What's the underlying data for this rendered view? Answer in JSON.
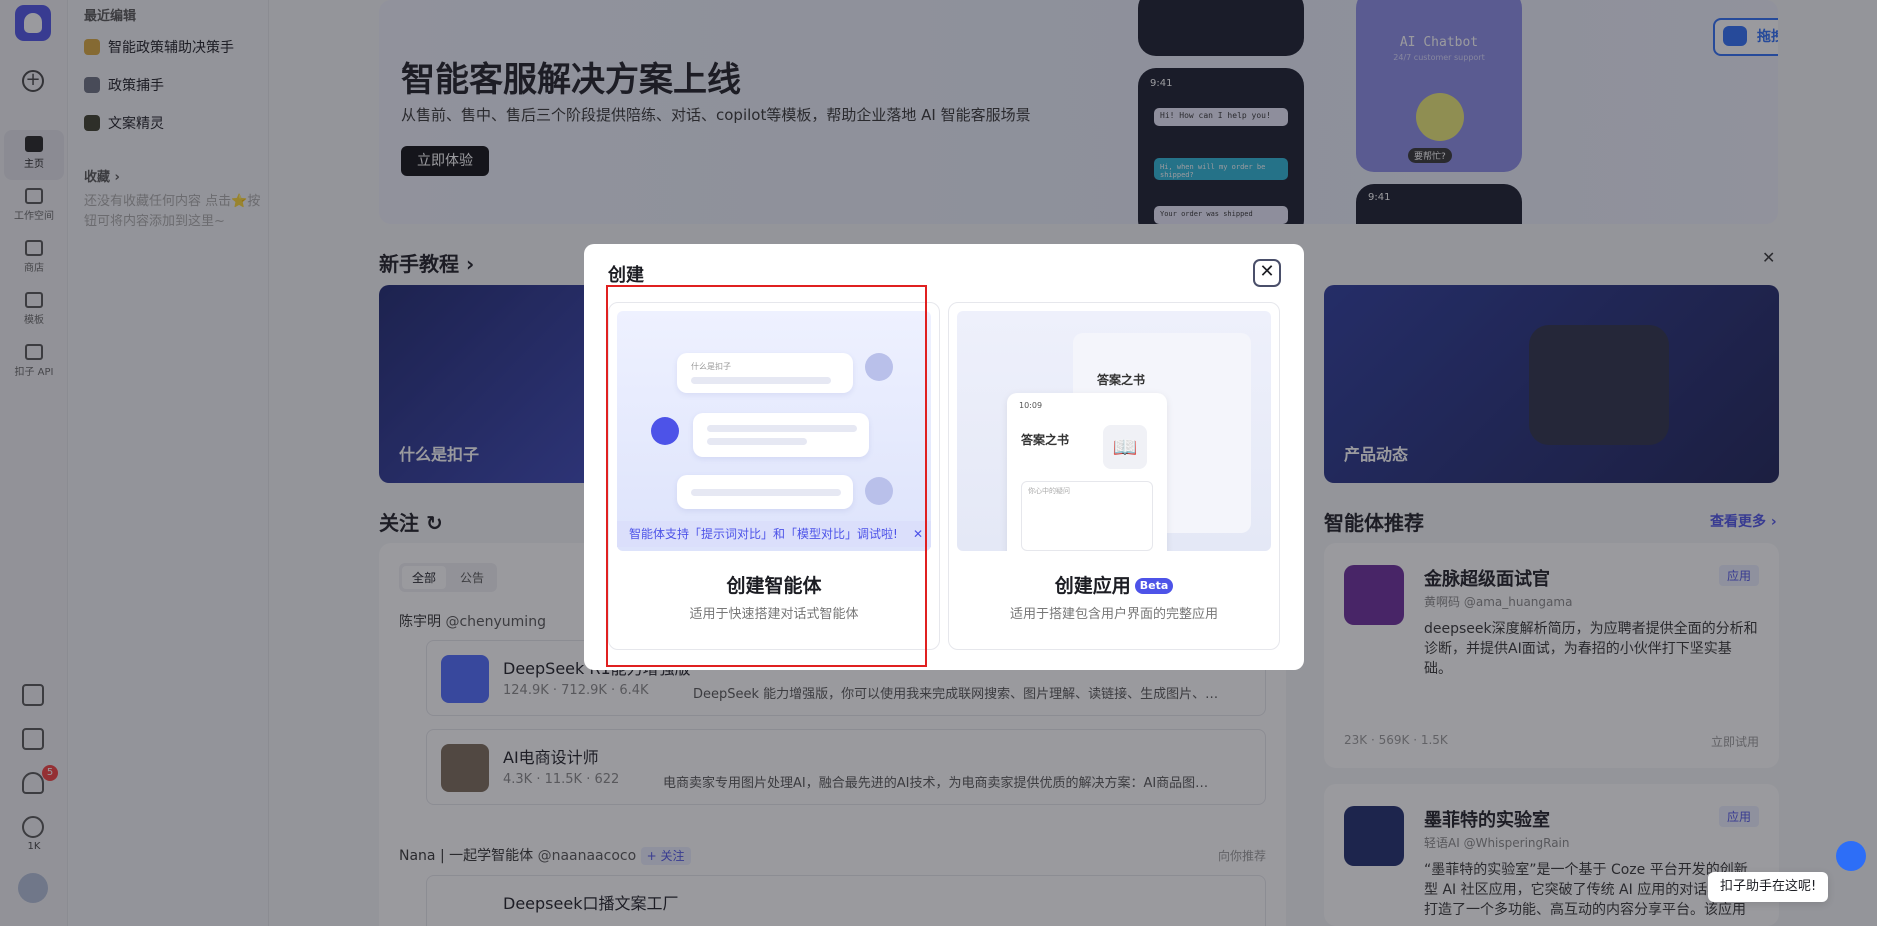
{
  "rail": {
    "items": [
      {
        "label": "主页",
        "icon": "home-icon"
      },
      {
        "label": "工作空间",
        "icon": "workspace-icon"
      },
      {
        "label": "商店",
        "icon": "store-icon"
      },
      {
        "label": "模板",
        "icon": "template-icon"
      },
      {
        "label": "扣子 API",
        "icon": "api-icon"
      }
    ],
    "notification_count": "5",
    "star_count": "1K"
  },
  "sidebar": {
    "recent_title": "最近编辑",
    "recent_items": [
      "智能政策辅助决策手",
      "政策捕手",
      "文案精灵"
    ],
    "favorites_title": "收藏",
    "favorites_hint": "还没有收藏任何内容 点击⭐按钮可将内容添加到这里~"
  },
  "banner": {
    "title": "智能客服解决方案上线",
    "subtitle": "从售前、售中、售后三个阶段提供陪练、对话、copilot等模板，帮助企业落地 AI 智能客服场景",
    "cta": "立即体验",
    "upload_label": "拖拽至此上传",
    "phone_title": "AI Chatbot",
    "phone_subtitle": "24/7 customer support",
    "phone_time": "9:41",
    "chat_lines": [
      "Hi! How can I help you!",
      "Hi, when will my order be shipped?",
      "Your order was shipped"
    ],
    "chat_sender": "AI Chatbot",
    "help_bubble": "要帮忙?"
  },
  "tutorial": {
    "title": "新手教程",
    "card_left": "什么是扣子",
    "card_right": "产品动态"
  },
  "follow": {
    "title": "关注",
    "tabs": [
      "全部",
      "公告"
    ],
    "author1": "陈宇明",
    "author1_handle": "@chenyuming",
    "posts": [
      {
        "title": "DeepSeek R1能力增强版",
        "users": "124.9K",
        "runs": "712.9K",
        "stars": "6.4K",
        "desc": "DeepSeek 能力增强版，你可以使用我来完成联网搜索、图片理解、读链接、生成图片、…"
      },
      {
        "title": "AI电商设计师",
        "users": "4.3K",
        "runs": "11.5K",
        "stars": "622",
        "desc": "电商卖家专用图片处理AI，融合最先进的AI技术，为电商卖家提供优质的解决方案：AI商品图…"
      }
    ],
    "author2": "Nana | 一起学智能体",
    "author2_handle": "@naanaacoco",
    "follow_btn": "+ 关注",
    "recommend_tag": "向你推荐",
    "post3_title": "Deepseek口播文案工厂"
  },
  "recommend": {
    "title": "智能体推荐",
    "more": "查看更多",
    "cards": [
      {
        "name": "金脉超级面试官",
        "author": "黄啊码",
        "handle": "@ama_huangama",
        "tag": "应用",
        "desc": "deepseek深度解析简历，为应聘者提供全面的分析和诊断，并提供AI面试，为春招的小伙伴打下坚实基础。",
        "users": "23K",
        "runs": "569K",
        "stars": "1.5K",
        "try": "立即试用"
      },
      {
        "name": "墨菲特的实验室",
        "author": "轻语AI",
        "handle": "@WhisperingRain",
        "tag": "应用",
        "desc": "“墨菲特的实验室”是一个基于 Coze 平台开发的创新型 AI 社区应用，它突破了传统 AI 应用的对话模式，打造了一个多功能、高互动的内容分享平台。该应用包…"
      }
    ]
  },
  "modal": {
    "title": "创建",
    "option_agent": {
      "name": "创建智能体",
      "desc": "适用于快速搭建对话式智能体",
      "tip": "智能体支持「提示词对比」和「模型对比」调试啦!",
      "bubble_text": "什么是扣子"
    },
    "option_app": {
      "name": "创建应用",
      "badge": "Beta",
      "desc": "适用于搭建包含用户界面的完整应用",
      "book_title": "答案之书",
      "time": "10:09",
      "input_hint": "你心中的疑问"
    }
  },
  "help_widget": "扣子助手在这呢!"
}
